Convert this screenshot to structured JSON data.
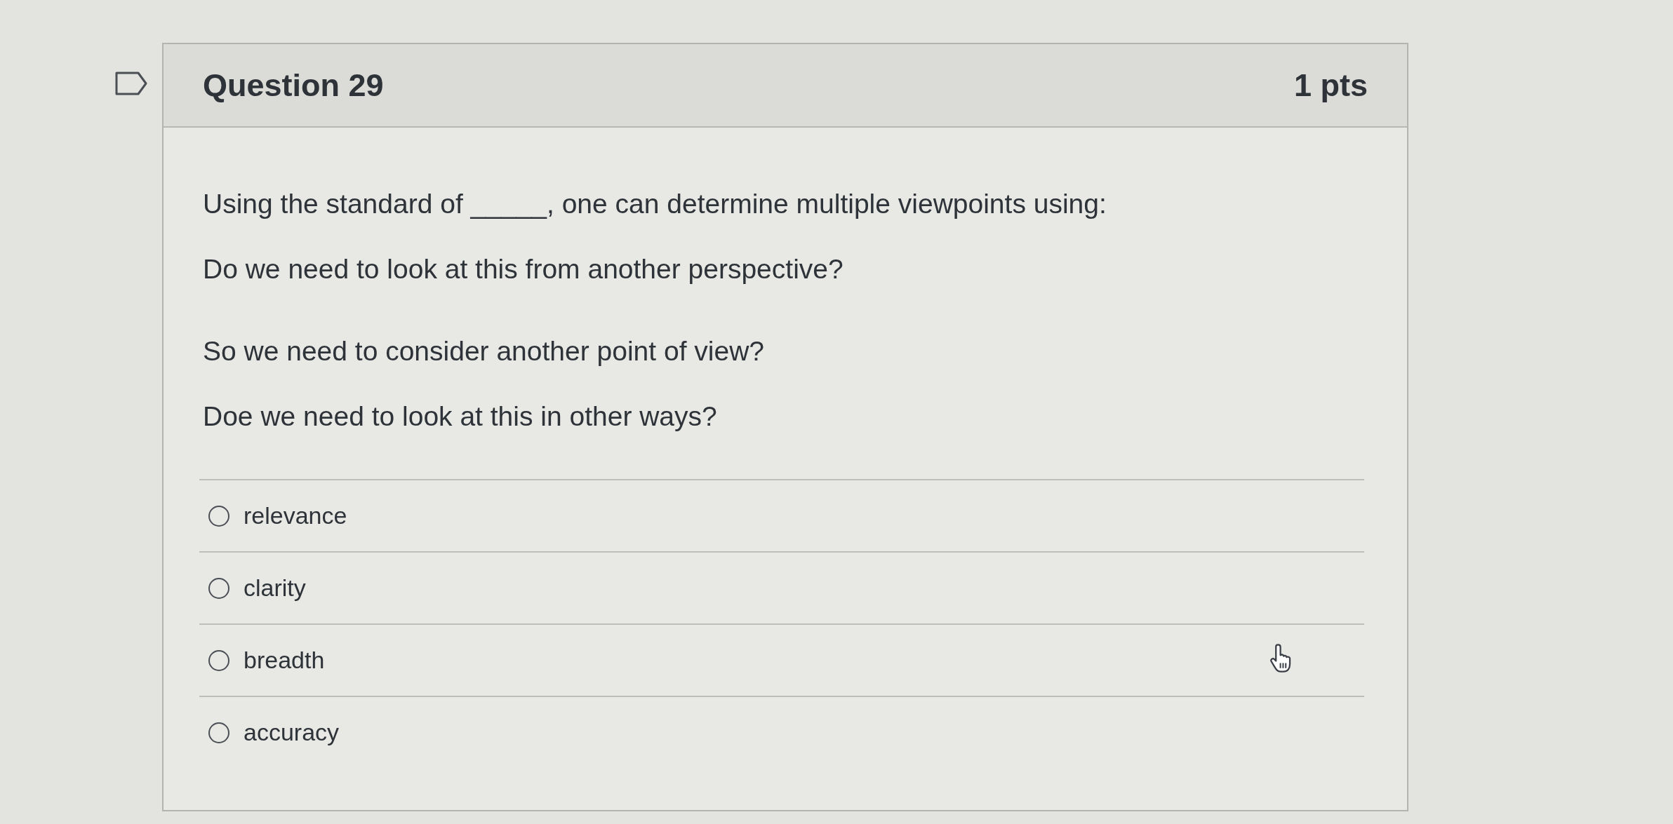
{
  "question": {
    "flagged": false,
    "title": "Question 29",
    "points": "1 pts"
  },
  "paragraphs": [
    "Using the standard of _____, one can determine multiple viewpoints using:",
    "Do we need to look at this from another perspective?",
    "So we need to consider another point of view?",
    "Doe we need to look at this in other ways?"
  ],
  "answers": [
    {
      "label": "relevance",
      "selected": false
    },
    {
      "label": "clarity",
      "selected": false
    },
    {
      "label": "breadth",
      "selected": false
    },
    {
      "label": "accuracy",
      "selected": false
    }
  ]
}
